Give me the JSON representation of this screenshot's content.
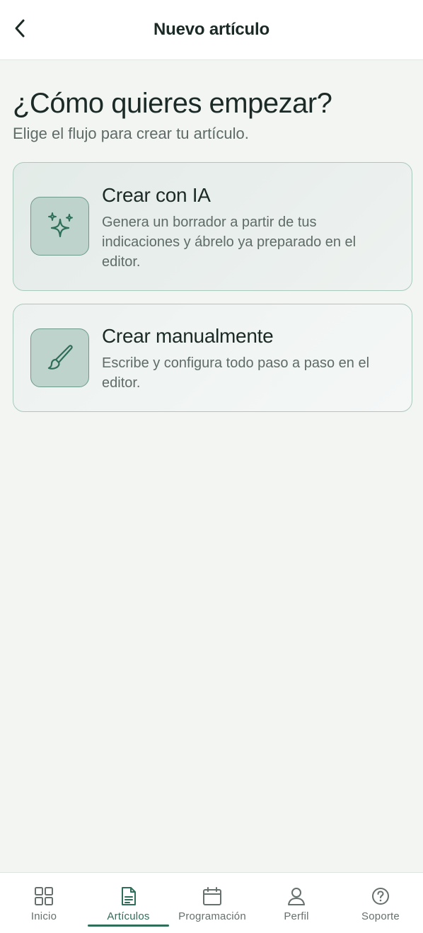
{
  "header": {
    "title": "Nuevo artículo",
    "back_icon": "chevron-left-icon"
  },
  "main": {
    "title": "¿Cómo quieres empezar?",
    "subtitle": "Elige el flujo para crear tu artículo.",
    "options": [
      {
        "icon": "sparkles-icon",
        "title": "Crear con IA",
        "description": "Genera un borrador a partir de tus indicaciones y ábrelo ya preparado en el editor."
      },
      {
        "icon": "brush-icon",
        "title": "Crear manualmente",
        "description": "Escribe y configura todo paso a paso en el editor."
      }
    ]
  },
  "tabbar": {
    "active": "Artículos",
    "tabs": [
      {
        "label": "Inicio",
        "icon": "grid-icon"
      },
      {
        "label": "Artículos",
        "icon": "document-icon"
      },
      {
        "label": "Programación",
        "icon": "calendar-icon"
      },
      {
        "label": "Perfil",
        "icon": "user-icon"
      },
      {
        "label": "Soporte",
        "icon": "help-circle-icon"
      }
    ]
  },
  "colors": {
    "accent": "#2f6e58",
    "card_border": "#a9c9bd",
    "icon_bg": "#bdd3cc",
    "background": "#f3f5f3",
    "text_primary": "#1b2a26",
    "text_secondary": "#5e6b67"
  }
}
